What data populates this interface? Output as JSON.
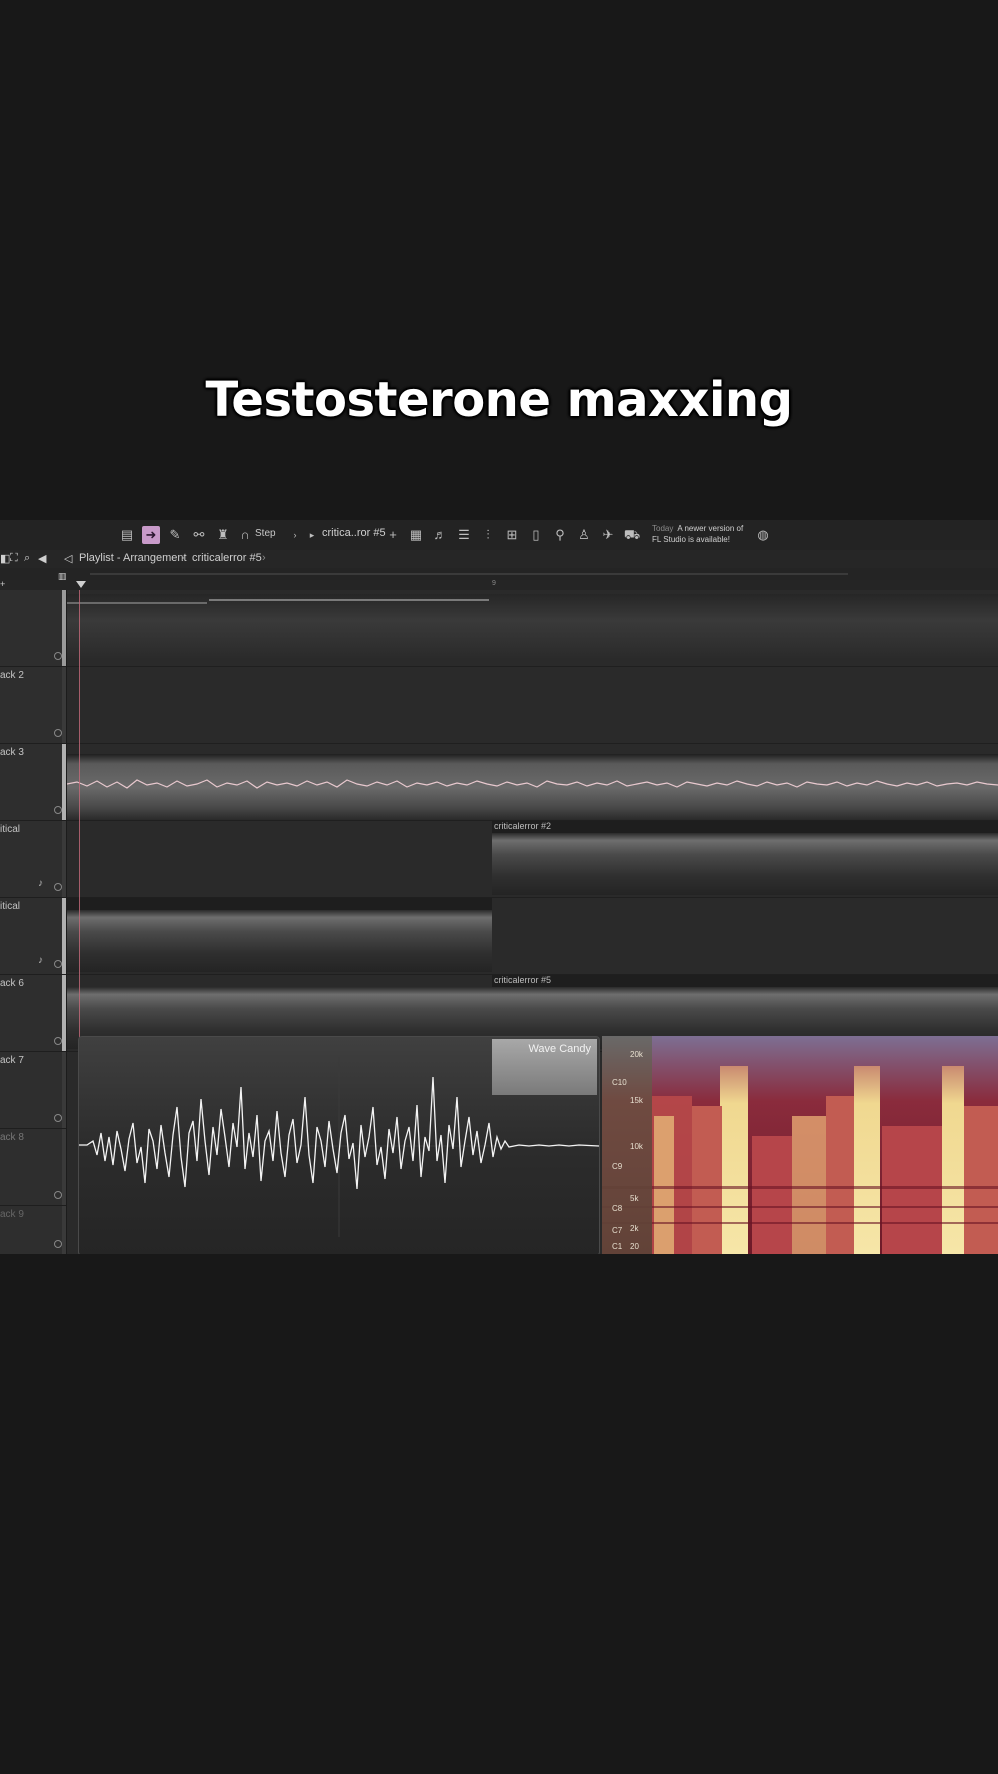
{
  "caption": "Testosterone maxxing",
  "toolbar": {
    "step_label": "Step",
    "pattern_label": "critica..ror #5",
    "news_today": "Today",
    "news_line1": "A newer version of",
    "news_line2": "FL Studio is available!"
  },
  "breadcrumb": {
    "window": "Playlist - Arrangement",
    "separator": "›",
    "pattern": "criticalerror #5"
  },
  "tracks": [
    {
      "name": ""
    },
    {
      "name": "ack 2"
    },
    {
      "name": "ack 3"
    },
    {
      "name": "itical"
    },
    {
      "name": "itical"
    },
    {
      "name": "ack 6"
    },
    {
      "name": "ack 7"
    },
    {
      "name": "ack 8"
    },
    {
      "name": "ack 9"
    }
  ],
  "clips": {
    "clip_a": "criticalerror #2",
    "clip_b": "criticalerror #5"
  },
  "wave_candy": {
    "label": "Wave Candy",
    "freq_labels": [
      "20k",
      "C10",
      "15k",
      "10k",
      "C9",
      "5k",
      "C8",
      "C7",
      "2k",
      "C1",
      "20"
    ]
  },
  "colors": {
    "accent_pink": "#c89ac9",
    "playhead": "#c56a7a",
    "background": "#181818"
  }
}
